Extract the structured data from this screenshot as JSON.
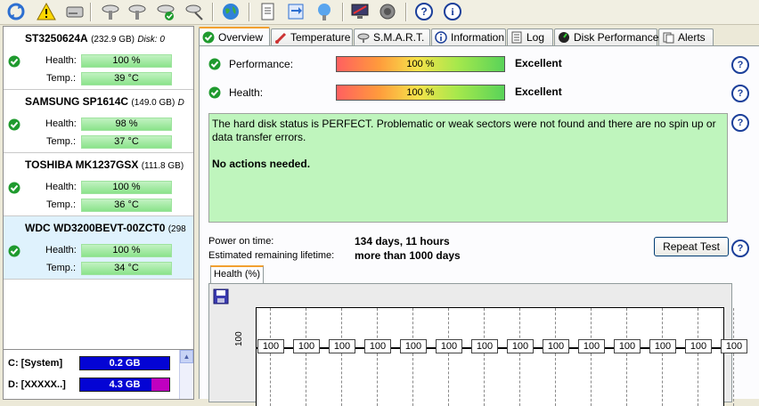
{
  "toolbar": {
    "buttons": [
      "refresh-icon",
      "alert-icon",
      "drive-icon",
      "drive-config-icon",
      "drive-settings-icon",
      "drive-ok-icon",
      "drive-search-icon",
      "globe-icon",
      "notes-icon",
      "transfer-icon",
      "network-icon",
      "monitor-icon",
      "speaker-icon",
      "help-icon",
      "info-icon"
    ]
  },
  "disks": [
    {
      "name": "ST3250624A",
      "size": "(232.9 GB)",
      "hint": "Disk: 0",
      "health_label": "Health:",
      "health": "100 %",
      "temp_label": "Temp.:",
      "temp": "39 °C"
    },
    {
      "name": "SAMSUNG SP1614C",
      "size": "(149.0 GB)",
      "hint": "D",
      "health_label": "Health:",
      "health": "98 %",
      "temp_label": "Temp.:",
      "temp": "37 °C"
    },
    {
      "name": "TOSHIBA MK1237GSX",
      "size": "(111.8 GB)",
      "hint": "",
      "health_label": "Health:",
      "health": "100 %",
      "temp_label": "Temp.:",
      "temp": "36 °C"
    },
    {
      "name": "WDC WD3200BEVT-00ZCT0",
      "size": "(298",
      "hint": "",
      "health_label": "Health:",
      "health": "100 %",
      "temp_label": "Temp.:",
      "temp": "34 °C"
    }
  ],
  "drives": [
    {
      "label": "C: [System]",
      "value": "0.2 GB"
    },
    {
      "label": "D: [XXXXX..]",
      "value": "4.3 GB"
    }
  ],
  "tabs": [
    {
      "label": "Overview",
      "icon": "check-icon"
    },
    {
      "label": "Temperature",
      "icon": "thermometer-icon"
    },
    {
      "label": "S.M.A.R.T.",
      "icon": "smart-icon"
    },
    {
      "label": "Information",
      "icon": "info-icon"
    },
    {
      "label": "Log",
      "icon": "log-icon"
    },
    {
      "label": "Disk Performance",
      "icon": "performance-icon"
    },
    {
      "label": "Alerts",
      "icon": "alerts-icon"
    }
  ],
  "overview": {
    "performance_label": "Performance:",
    "performance_value": "100 %",
    "performance_grade": "Excellent",
    "health_label": "Health:",
    "health_value": "100 %",
    "health_grade": "Excellent",
    "status_text": "The hard disk status is PERFECT. Problematic or weak sectors were not found and there are no spin up or data transfer errors.",
    "action_text": "No actions needed.",
    "power_on_label": "Power on time:",
    "power_on_value": "134 days, 11 hours",
    "lifetime_label": "Estimated remaining lifetime:",
    "lifetime_value": "more than 1000 days",
    "repeat_button": "Repeat Test"
  },
  "chart_tab": "Health (%)",
  "chart_data": {
    "type": "line",
    "y_tick": "100",
    "values": [
      100,
      100,
      100,
      100,
      100,
      100,
      100,
      100,
      100,
      100,
      100,
      100,
      100,
      100
    ],
    "labels": [
      "100",
      "100",
      "100",
      "100",
      "100",
      "100",
      "100",
      "100",
      "100",
      "100",
      "100",
      "100",
      "100",
      "100"
    ]
  },
  "colors": {
    "ok_green": "#1f9a2e",
    "bar_green": "#8be38b",
    "drive_blue": "#0404d4",
    "drive_magenta": "#c000c0",
    "status_green": "#bff5bd"
  }
}
